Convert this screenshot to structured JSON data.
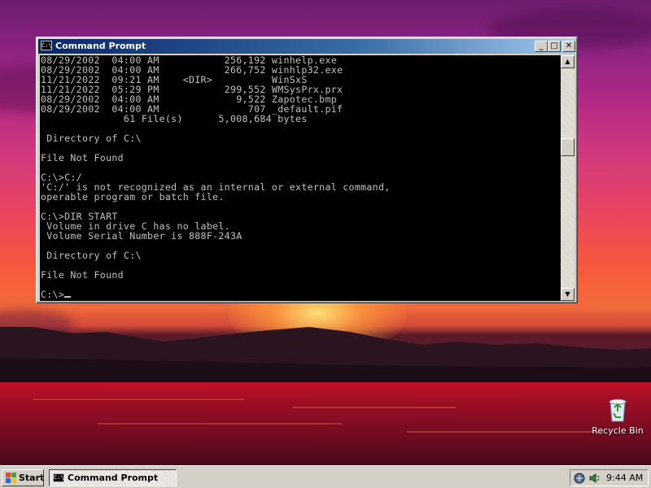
{
  "window": {
    "title": "Command Prompt",
    "icon": "C:\\",
    "buttons": {
      "minimize": "_",
      "maximize": "□",
      "close": "✕"
    },
    "console_lines": [
      "08/29/2002  04:00 AM           256,192 winhelp.exe",
      "08/29/2002  04:00 AM           266,752 winhlp32.exe",
      "11/21/2022  09:21 AM    <DIR>          WinSxS",
      "11/21/2022  05:29 PM           299,552 WMSysPrx.prx",
      "08/29/2002  04:00 AM             9,522 Zapotec.bmp",
      "08/29/2002  04:00 AM               707 _default.pif",
      "              61 File(s)      5,008,684 bytes",
      "",
      " Directory of C:\\",
      "",
      "File Not Found",
      "",
      "C:\\>C:/",
      "'C:/' is not recognized as an internal or external command,",
      "operable program or batch file.",
      "",
      "C:\\>DIR START",
      " Volume in drive C has no label.",
      " Volume Serial Number is 888F-243A",
      "",
      " Directory of C:\\",
      "",
      "File Not Found",
      ""
    ],
    "prompt": "C:\\>",
    "scrollbar": {
      "up": "▲",
      "down": "▼"
    }
  },
  "desktop": {
    "recycle_bin_label": "Recycle Bin"
  },
  "taskbar": {
    "start_label": "Start",
    "task_label": "Command Prompt",
    "clock": "9:44 AM"
  }
}
